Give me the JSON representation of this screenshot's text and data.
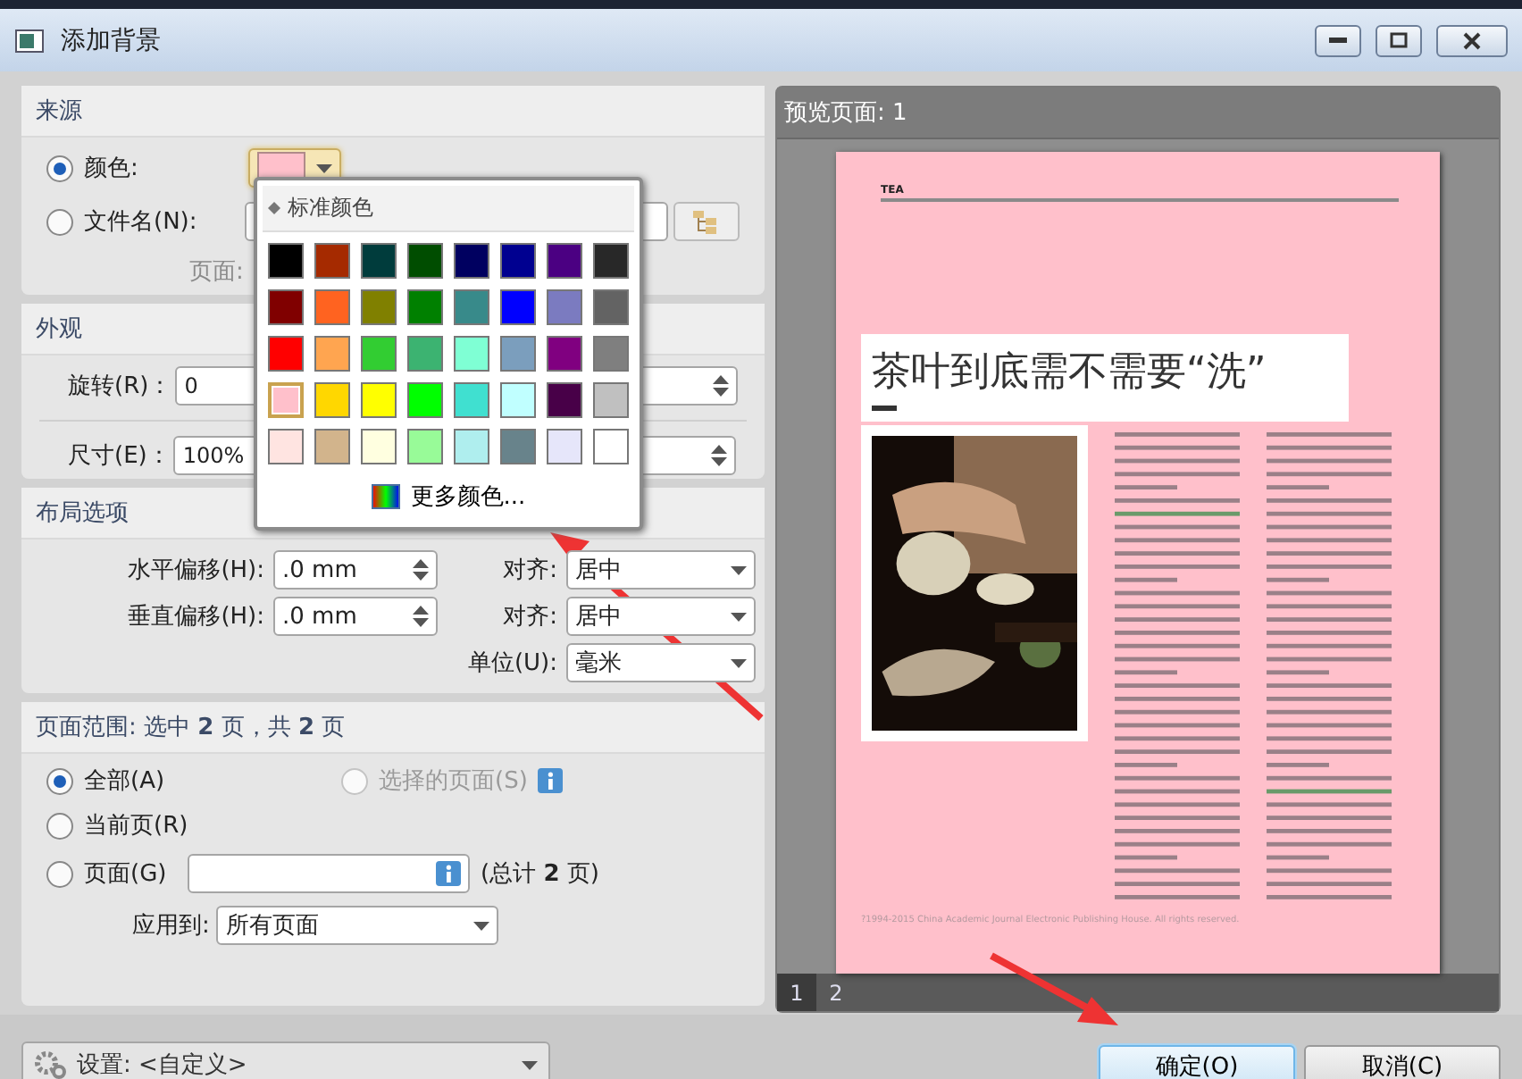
{
  "window": {
    "title": "添加背景"
  },
  "source": {
    "title": "来源",
    "options": [
      {
        "label": "颜色:",
        "selected": true
      },
      {
        "label": "文件名(N):",
        "selected": false
      }
    ],
    "page_label": "页面:",
    "color_button": {
      "color": "#ffc0cb",
      "expanded": true
    }
  },
  "color_popup": {
    "title": "标准颜色",
    "more": "更多颜色...",
    "swatches": [
      {
        "color": "#000000",
        "selected": false
      },
      {
        "color": "#a52a00",
        "selected": false
      },
      {
        "color": "#003c3c",
        "selected": false
      },
      {
        "color": "#004d00",
        "selected": false
      },
      {
        "color": "#000060",
        "selected": false
      },
      {
        "color": "#000090",
        "selected": false
      },
      {
        "color": "#4b0082",
        "selected": false
      },
      {
        "color": "#282828",
        "selected": false
      },
      {
        "color": "#800000",
        "selected": false
      },
      {
        "color": "#ff6320",
        "selected": false
      },
      {
        "color": "#808000",
        "selected": false
      },
      {
        "color": "#008000",
        "selected": false
      },
      {
        "color": "#388a8a",
        "selected": false
      },
      {
        "color": "#0000ff",
        "selected": false
      },
      {
        "color": "#7b7bc0",
        "selected": false
      },
      {
        "color": "#636363",
        "selected": false
      },
      {
        "color": "#ff0000",
        "selected": false
      },
      {
        "color": "#ffa550",
        "selected": false
      },
      {
        "color": "#32cd32",
        "selected": false
      },
      {
        "color": "#3cb371",
        "selected": false
      },
      {
        "color": "#7fffd4",
        "selected": false
      },
      {
        "color": "#7b9ebd",
        "selected": false
      },
      {
        "color": "#800080",
        "selected": false
      },
      {
        "color": "#7f7f7f",
        "selected": false
      },
      {
        "color": "#ffc0cb",
        "selected": true
      },
      {
        "color": "#ffd700",
        "selected": false
      },
      {
        "color": "#ffff00",
        "selected": false
      },
      {
        "color": "#00ff00",
        "selected": false
      },
      {
        "color": "#40e0d0",
        "selected": false
      },
      {
        "color": "#c0ffff",
        "selected": false
      },
      {
        "color": "#480048",
        "selected": false
      },
      {
        "color": "#c0c0c0",
        "selected": false
      },
      {
        "color": "#ffe4e1",
        "selected": false
      },
      {
        "color": "#d2b48c",
        "selected": false
      },
      {
        "color": "#ffffe0",
        "selected": false
      },
      {
        "color": "#98fb98",
        "selected": false
      },
      {
        "color": "#afeeee",
        "selected": false
      },
      {
        "color": "#68838b",
        "selected": false
      },
      {
        "color": "#e6e6fa",
        "selected": false
      },
      {
        "color": "#ffffff",
        "selected": false
      }
    ]
  },
  "appearance": {
    "title": "外观",
    "rotation": {
      "label": "旋转(R)：",
      "value": "0"
    },
    "size": {
      "label": "尺寸(E)：",
      "value": "100%"
    }
  },
  "layout": {
    "title": "布局选项",
    "rows": [
      {
        "label": "水平偏移(H):",
        "value": ".0 mm",
        "align_label": "对齐:",
        "align_value": "居中"
      },
      {
        "label": "垂直偏移(H):",
        "value": ".0 mm",
        "align_label": "对齐:",
        "align_value": "居中"
      }
    ],
    "unit": {
      "label": "单位(U):",
      "value": "毫米"
    }
  },
  "page_range": {
    "title": "页面范围: 选中 **2** 页，共 **2** 页",
    "options": [
      {
        "label": "全部(A)",
        "selected": true,
        "disabled": false
      },
      {
        "label": "选择的页面(S)",
        "selected": false,
        "disabled": true
      },
      {
        "label": "当前页(R)",
        "selected": false,
        "disabled": false
      },
      {
        "label": "页面(G)",
        "selected": false,
        "disabled": false
      }
    ],
    "total": "(总计 **2** 页)",
    "apply_label": "应用到:",
    "apply_value": "所有页面"
  },
  "preview": {
    "title": "预览页面: 1",
    "page": {
      "header": "TEA",
      "headline": "茶叶到底需不需要“洗”",
      "footer": "?1994-2015 China Academic Journal Electronic Publishing House. All rights reserved."
    },
    "pages": [
      {
        "label": "1",
        "selected": true
      },
      {
        "label": "2",
        "selected": false
      }
    ]
  },
  "settings": {
    "label": "设置: <自定义>"
  },
  "buttons": [
    {
      "label": "确定(O)",
      "focused": true
    },
    {
      "label": "取消(C)",
      "focused": false
    }
  ]
}
